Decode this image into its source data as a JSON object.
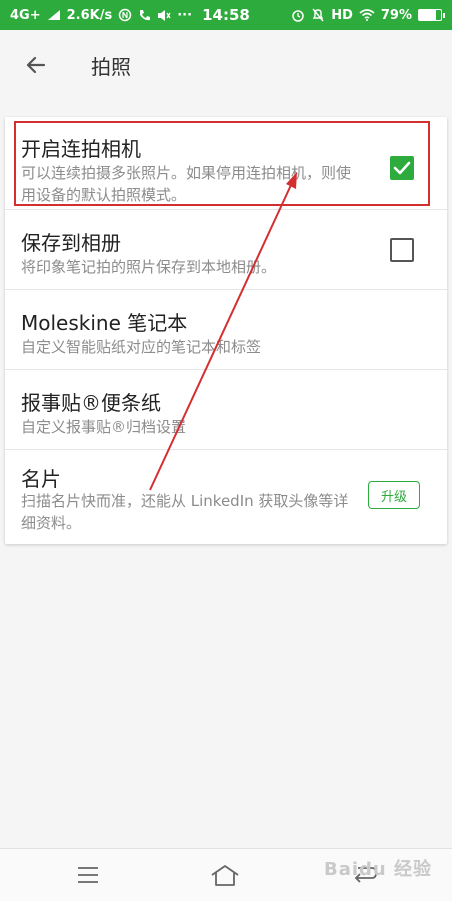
{
  "status_bar": {
    "network": "4G+",
    "speed": "2.6K/s",
    "time": "14:58",
    "hd": "HD",
    "battery": "79%",
    "battery_level": 0.79
  },
  "header": {
    "title": "拍照"
  },
  "settings": [
    {
      "title": "开启连拍相机",
      "desc": "可以连续拍摄多张照片。如果停用连拍相机，则使用设备的默认拍照模式。",
      "control": "checkbox",
      "checked": true
    },
    {
      "title": "保存到相册",
      "desc": "将印象笔记拍的照片保存到本地相册。",
      "control": "checkbox",
      "checked": false
    },
    {
      "title": "Moleskine 笔记本",
      "desc": "自定义智能贴纸对应的笔记本和标签",
      "control": "none"
    },
    {
      "title": "报事贴®便条纸",
      "desc": "自定义报事贴®归档设置",
      "control": "none"
    },
    {
      "title": "名片",
      "desc": "扫描名片快而准，还能从 LinkedIn 获取头像等详细资料。",
      "control": "button",
      "button_label": "升级"
    }
  ],
  "watermark": "Baidu 经验",
  "colors": {
    "accent": "#2dab3c",
    "annotation": "#d32f2f"
  }
}
